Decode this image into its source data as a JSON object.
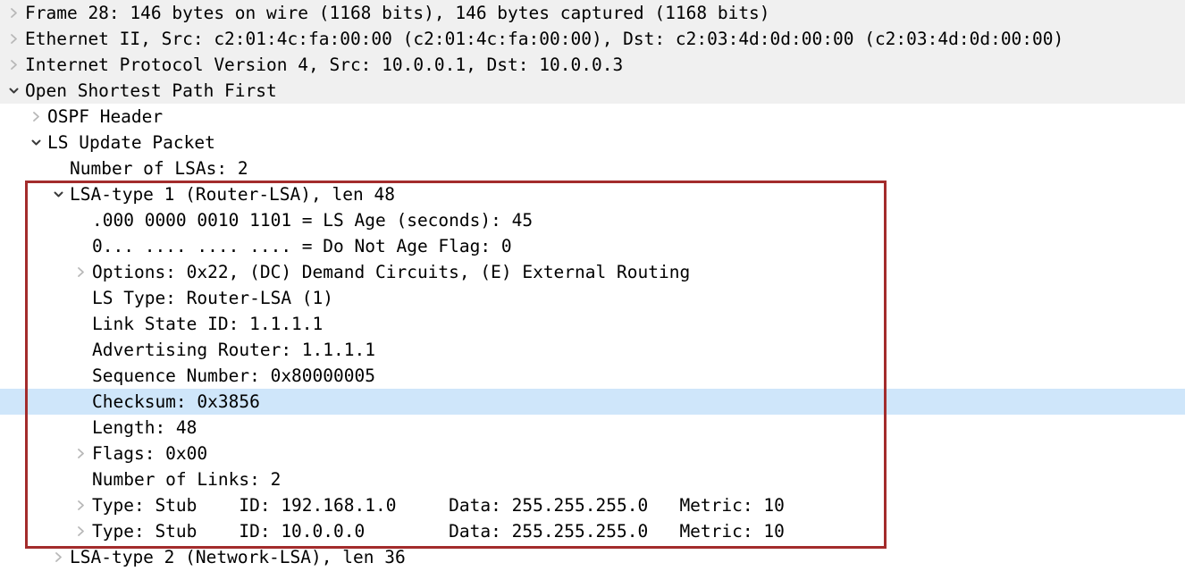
{
  "panel": {
    "name": "packet-details-tree",
    "selection_color": "#cfe6fa",
    "header_bg_color": "#f0f0f0",
    "annotation_box_color": "#a32c2c"
  },
  "rows": [
    {
      "id": "frame",
      "text": "Frame 28: 146 bytes on wire (1168 bits), 146 bytes captured (1168 bits)",
      "level": 0,
      "state": "collapsed",
      "background": "gray",
      "selected": false
    },
    {
      "id": "ethernet",
      "text": "Ethernet II, Src: c2:01:4c:fa:00:00 (c2:01:4c:fa:00:00), Dst: c2:03:4d:0d:00:00 (c2:03:4d:0d:00:00)",
      "level": 0,
      "state": "collapsed",
      "background": "gray",
      "selected": false
    },
    {
      "id": "ipv4",
      "text": "Internet Protocol Version 4, Src: 10.0.0.1, Dst: 10.0.0.3",
      "level": 0,
      "state": "collapsed",
      "background": "gray",
      "selected": false
    },
    {
      "id": "ospf",
      "text": "Open Shortest Path First",
      "level": 0,
      "state": "expanded",
      "background": "gray",
      "selected": false
    },
    {
      "id": "ospf-header",
      "text": "OSPF Header",
      "level": 1,
      "state": "collapsed",
      "background": "none",
      "selected": false
    },
    {
      "id": "ls-update-packet",
      "text": "LS Update Packet",
      "level": 1,
      "state": "expanded",
      "background": "none",
      "selected": false
    },
    {
      "id": "number-of-lsas",
      "text": "Number of LSAs: 2",
      "level": 2,
      "state": "leaf",
      "background": "none",
      "selected": false
    },
    {
      "id": "lsa-type-1",
      "text": "LSA-type 1 (Router-LSA), len 48",
      "level": 2,
      "state": "expanded",
      "background": "none",
      "selected": false
    },
    {
      "id": "ls-age",
      "text": ".000 0000 0010 1101 = LS Age (seconds): 45",
      "level": 3,
      "state": "leaf",
      "background": "none",
      "selected": false
    },
    {
      "id": "do-not-age-flag",
      "text": "0... .... .... .... = Do Not Age Flag: 0",
      "level": 3,
      "state": "leaf",
      "background": "none",
      "selected": false
    },
    {
      "id": "options",
      "text": "Options: 0x22, (DC) Demand Circuits, (E) External Routing",
      "level": 3,
      "state": "collapsed",
      "background": "none",
      "selected": false
    },
    {
      "id": "ls-type",
      "text": "LS Type: Router-LSA (1)",
      "level": 3,
      "state": "leaf",
      "background": "none",
      "selected": false
    },
    {
      "id": "link-state-id",
      "text": "Link State ID: 1.1.1.1",
      "level": 3,
      "state": "leaf",
      "background": "none",
      "selected": false
    },
    {
      "id": "advertising-router",
      "text": "Advertising Router: 1.1.1.1",
      "level": 3,
      "state": "leaf",
      "background": "none",
      "selected": false
    },
    {
      "id": "sequence-number",
      "text": "Sequence Number: 0x80000005",
      "level": 3,
      "state": "leaf",
      "background": "none",
      "selected": false
    },
    {
      "id": "checksum",
      "text": "Checksum: 0x3856",
      "level": 3,
      "state": "leaf",
      "background": "none",
      "selected": true
    },
    {
      "id": "length",
      "text": "Length: 48",
      "level": 3,
      "state": "leaf",
      "background": "none",
      "selected": false
    },
    {
      "id": "flags",
      "text": "Flags: 0x00",
      "level": 3,
      "state": "collapsed",
      "background": "none",
      "selected": false
    },
    {
      "id": "number-of-links",
      "text": "Number of Links: 2",
      "level": 3,
      "state": "leaf",
      "background": "none",
      "selected": false
    },
    {
      "id": "link-stub-1",
      "text": "Type: Stub    ID: 192.168.1.0     Data: 255.255.255.0   Metric: 10",
      "level": 3,
      "state": "collapsed",
      "background": "none",
      "selected": false
    },
    {
      "id": "link-stub-2",
      "text": "Type: Stub    ID: 10.0.0.0        Data: 255.255.255.0   Metric: 10",
      "level": 3,
      "state": "collapsed",
      "background": "none",
      "selected": false
    },
    {
      "id": "lsa-type-2",
      "text": "LSA-type 2 (Network-LSA), len 36",
      "level": 2,
      "state": "collapsed",
      "background": "none",
      "selected": false
    }
  ]
}
